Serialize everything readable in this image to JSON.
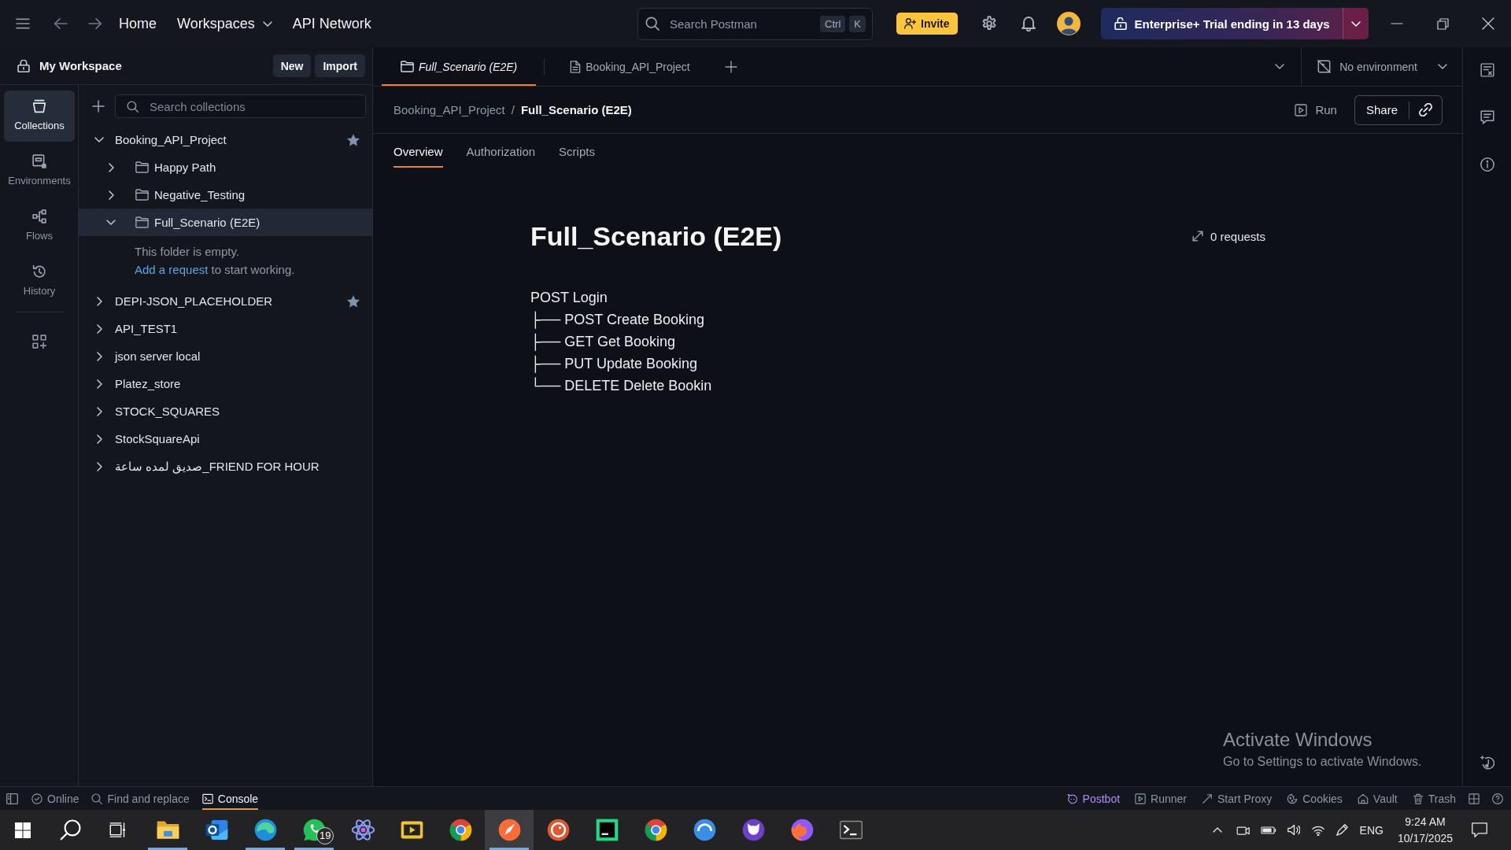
{
  "top_bar": {
    "nav": [
      {
        "label": "Home",
        "dropdown": false
      },
      {
        "label": "Workspaces",
        "dropdown": true
      },
      {
        "label": "API Network",
        "dropdown": false
      }
    ],
    "search": {
      "placeholder": "Search Postman",
      "keys": [
        "Ctrl",
        "K"
      ]
    },
    "invite": "Invite",
    "trial_banner": "Enterprise+ Trial ending in 13 days"
  },
  "sidebar": {
    "workspace": "My Workspace",
    "buttons": [
      "New",
      "Import"
    ],
    "rail": [
      {
        "kind": "collections",
        "label": "Collections",
        "selected": true
      },
      {
        "kind": "environments",
        "label": "Environments",
        "selected": false
      },
      {
        "kind": "flows",
        "label": "Flows",
        "selected": false
      },
      {
        "kind": "history",
        "label": "History",
        "selected": false
      }
    ],
    "search": {
      "placeholder": "Search collections"
    },
    "collections": [
      {
        "label": "Booking_API_Project",
        "expanded": true,
        "starred": true,
        "selected": false,
        "children": [
          {
            "label": "Happy Path",
            "expanded": false,
            "selected": false
          },
          {
            "label": "Negative_Testing",
            "expanded": false,
            "selected": false
          },
          {
            "label": "Full_Scenario (E2E)",
            "expanded": true,
            "selected": true,
            "empty_note": "This folder is empty.",
            "empty_hint": {
              "link": "Add a request",
              "text": "to start working."
            }
          }
        ]
      },
      {
        "label": "DEPI-JSON_PLACEHOLDER",
        "expanded": false,
        "starred": true,
        "selected": false
      },
      {
        "label": "API_TEST1",
        "expanded": false,
        "starred": false,
        "selected": false
      },
      {
        "label": "json server local",
        "expanded": false,
        "starred": false,
        "selected": false
      },
      {
        "label": "Platez_store",
        "expanded": false,
        "starred": false,
        "selected": false
      },
      {
        "label": "STOCK_SQUARES",
        "expanded": false,
        "starred": false,
        "selected": false
      },
      {
        "label": "StockSquareApi",
        "expanded": false,
        "starred": false,
        "selected": false
      },
      {
        "label": "صديق لمده ساعة_FRIEND FOR HOUR",
        "expanded": false,
        "starred": false,
        "selected": false
      }
    ]
  },
  "tabs": {
    "open": [
      {
        "kind": "folder",
        "label": "Full_Scenario (E2E)",
        "selected": true,
        "preview": true
      },
      {
        "kind": "collection",
        "label": "Booking_API_Project",
        "selected": false,
        "preview": false
      }
    ],
    "environment": "No environment"
  },
  "breadcrumb": {
    "items": [
      "Booking_API_Project",
      "Full_Scenario (E2E)"
    ],
    "separator": "/"
  },
  "actions": {
    "run": "Run",
    "share": "Share"
  },
  "detail_tabs": [
    {
      "label": "Overview",
      "selected": true
    },
    {
      "label": "Authorization",
      "selected": false
    },
    {
      "label": "Scripts",
      "selected": false
    }
  ],
  "overview": {
    "title": "Full_Scenario (E2E)",
    "request_count": "0 requests",
    "description": [
      "POST Login",
      "├── POST Create Booking",
      "├── GET Get Booking",
      "├── PUT Update Booking",
      "└── DELETE Delete Bookin"
    ]
  },
  "activation_notice": {
    "title": "Activate Windows",
    "text": "Go to Settings to activate Windows."
  },
  "status_bar": {
    "left": [
      {
        "kind": "online",
        "label": "Online",
        "selected": false
      },
      {
        "kind": "find",
        "label": "Find and replace",
        "selected": false
      },
      {
        "kind": "console",
        "label": "Console",
        "selected": true
      }
    ],
    "right": [
      {
        "kind": "postbot",
        "label": "Postbot"
      },
      {
        "kind": "runner",
        "label": "Runner"
      },
      {
        "kind": "proxy",
        "label": "Start Proxy"
      },
      {
        "kind": "cookies",
        "label": "Cookies"
      },
      {
        "kind": "vault",
        "label": "Vault"
      },
      {
        "kind": "trash",
        "label": "Trash"
      }
    ]
  },
  "taskbar": {
    "apps": [
      {
        "kind": "folder",
        "selected": false,
        "running": true
      },
      {
        "kind": "mail",
        "selected": false,
        "running": false
      },
      {
        "kind": "swirl",
        "selected": false,
        "running": true
      },
      {
        "kind": "chat",
        "selected": false,
        "running": true,
        "badge": "19"
      },
      {
        "kind": "orbit",
        "selected": false,
        "running": false
      },
      {
        "kind": "film",
        "selected": false,
        "running": false
      },
      {
        "kind": "wheel",
        "selected": false,
        "running": false
      },
      {
        "kind": "rocket",
        "selected": true,
        "running": true
      },
      {
        "kind": "ring",
        "selected": false,
        "running": false
      },
      {
        "kind": "code",
        "selected": false,
        "running": false
      },
      {
        "kind": "wheel",
        "selected": false,
        "running": false
      },
      {
        "kind": "bubble",
        "selected": false,
        "running": false
      },
      {
        "kind": "cat",
        "selected": false,
        "running": false
      },
      {
        "kind": "flame",
        "selected": false,
        "running": false
      },
      {
        "kind": "terminal",
        "selected": false,
        "running": false
      }
    ],
    "language": "ENG",
    "time": "9:24 AM",
    "date": "10/17/2025"
  }
}
